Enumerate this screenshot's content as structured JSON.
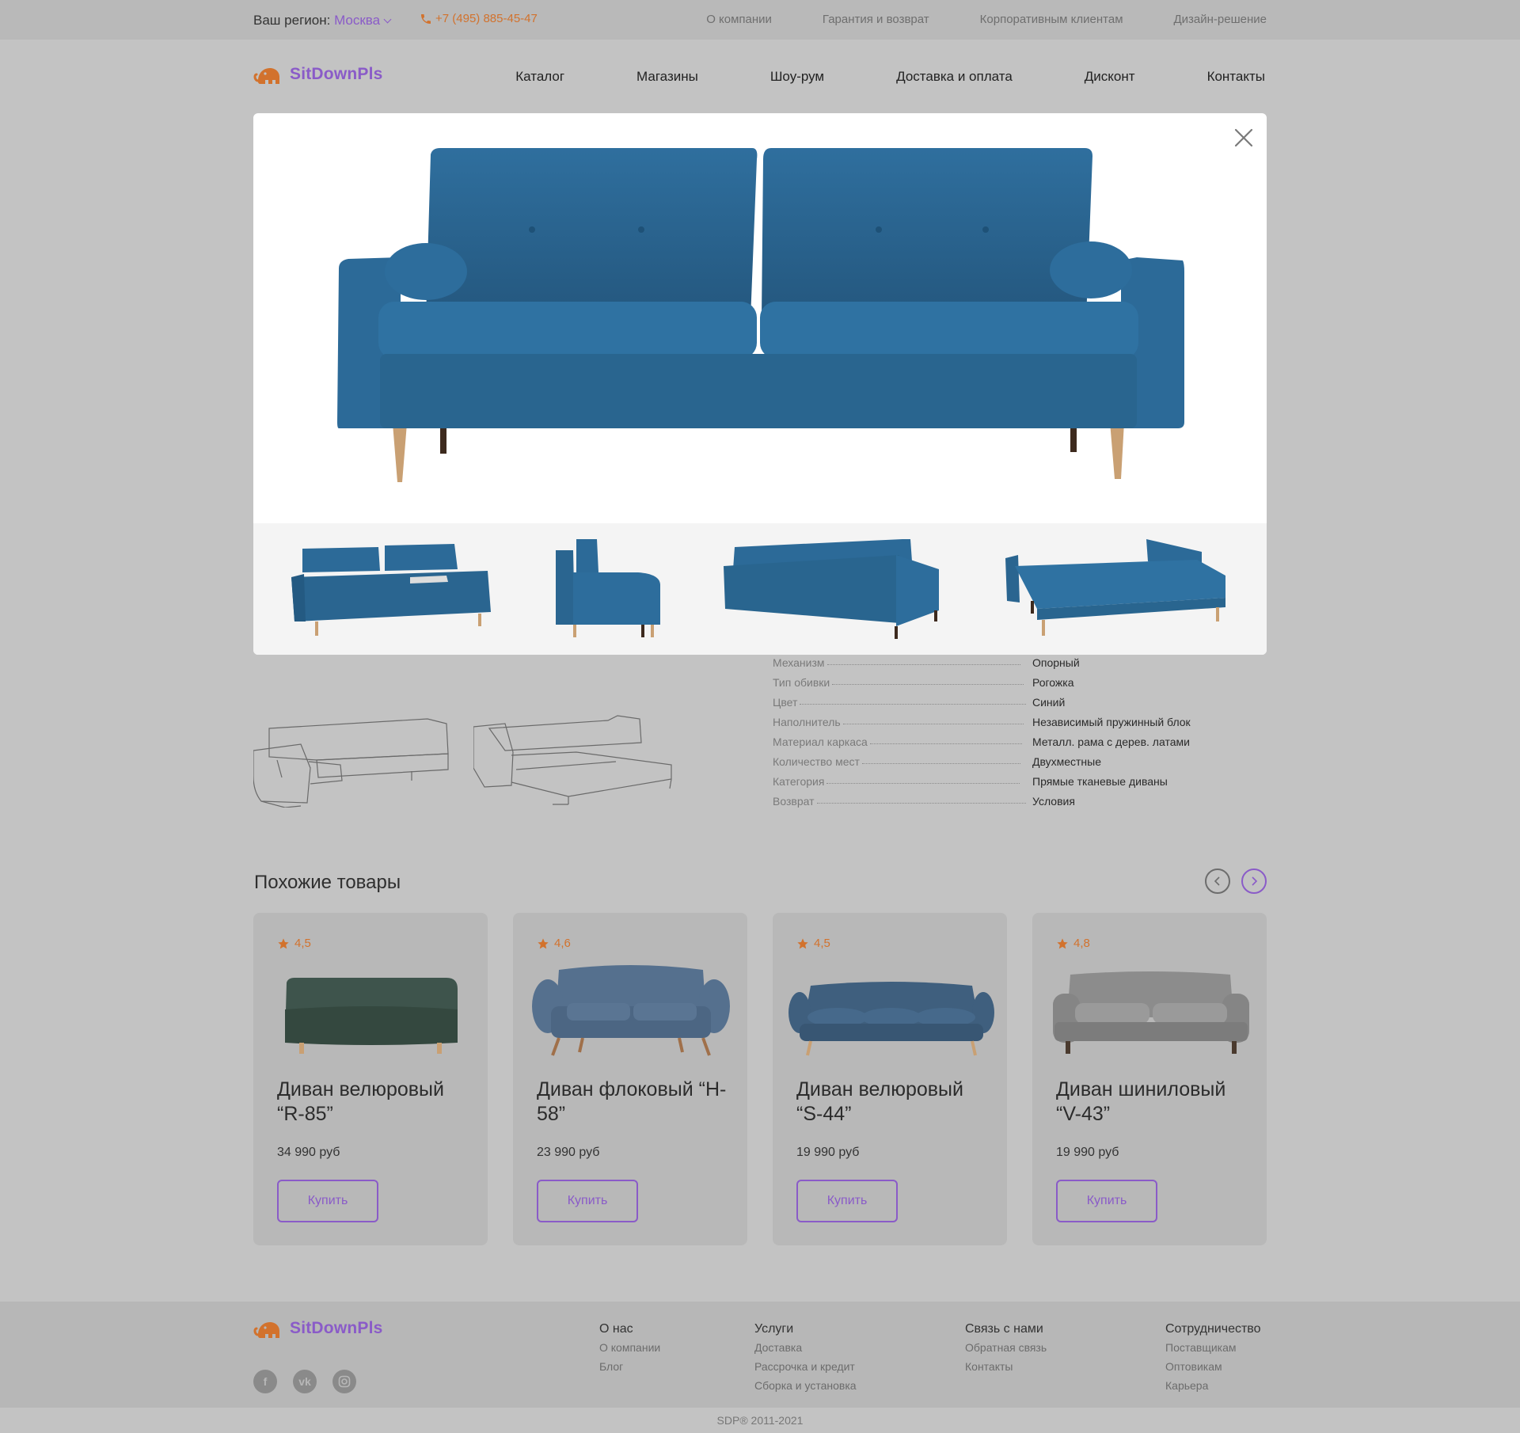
{
  "topbar": {
    "region_label": "Ваш регион:",
    "region_city": "Москва",
    "phone": "+7 (495) 885-45-47",
    "links": [
      "О компании",
      "Гарантия и возврат",
      "Корпоративным клиентам",
      "Дизайн-решение"
    ]
  },
  "header": {
    "logo_text": "SitDownPls",
    "nav": [
      "Каталог",
      "Магазины",
      "Шоу-рум",
      "Доставка и оплата",
      "Дисконт",
      "Контакты"
    ]
  },
  "modal": {
    "hero_color": "#2c6a98",
    "thumb_count": 4
  },
  "specs": [
    {
      "k": "Механизм",
      "v": "Опорный"
    },
    {
      "k": "Тип обивки",
      "v": "Рогожка"
    },
    {
      "k": "Цвет",
      "v": "Синий"
    },
    {
      "k": "Наполнитель",
      "v": "Независимый пружинный блок"
    },
    {
      "k": "Материал каркаса",
      "v": "Металл. рама с дерев. латами"
    },
    {
      "k": "Количество мест",
      "v": "Двухместные"
    },
    {
      "k": "Категория",
      "v": "Прямые тканевые диваны"
    },
    {
      "k": "Возврат",
      "v": "Условия"
    }
  ],
  "similar": {
    "title": "Похожие товары",
    "buy_label": "Купить",
    "items": [
      {
        "rating": "4,5",
        "name": "Диван велюровый “R-85”",
        "price": "34 990 руб",
        "color": "#3e544c"
      },
      {
        "rating": "4,6",
        "name": "Диван флоковый “H-58”",
        "price": "23 990 руб",
        "color": "#55708e"
      },
      {
        "rating": "4,5",
        "name": "Диван велюровый “S-44”",
        "price": "19 990 руб",
        "color": "#3f5f7e"
      },
      {
        "rating": "4,8",
        "name": "Диван шиниловый “V-43”",
        "price": "19 990 руб",
        "color": "#8c8c8c"
      }
    ]
  },
  "footer": {
    "logo_text": "SitDownPls",
    "columns": [
      {
        "title": "О нас",
        "links": [
          "О компании",
          "Блог"
        ]
      },
      {
        "title": "Услуги",
        "links": [
          "Доставка",
          "Рассрочка и кредит",
          "Сборка и установка"
        ]
      },
      {
        "title": "Связь с нами",
        "links": [
          "Обратная связь",
          "Контакты"
        ]
      },
      {
        "title": "Сотрудничество",
        "links": [
          "Поставщикам",
          "Оптовикам",
          "Карьера"
        ]
      }
    ],
    "social": [
      "facebook-icon",
      "vk-icon",
      "instagram-icon"
    ],
    "copyright": "SDP®   2011-2021"
  },
  "colors": {
    "accent": "#8a5bc8",
    "orange": "#d2722d"
  }
}
